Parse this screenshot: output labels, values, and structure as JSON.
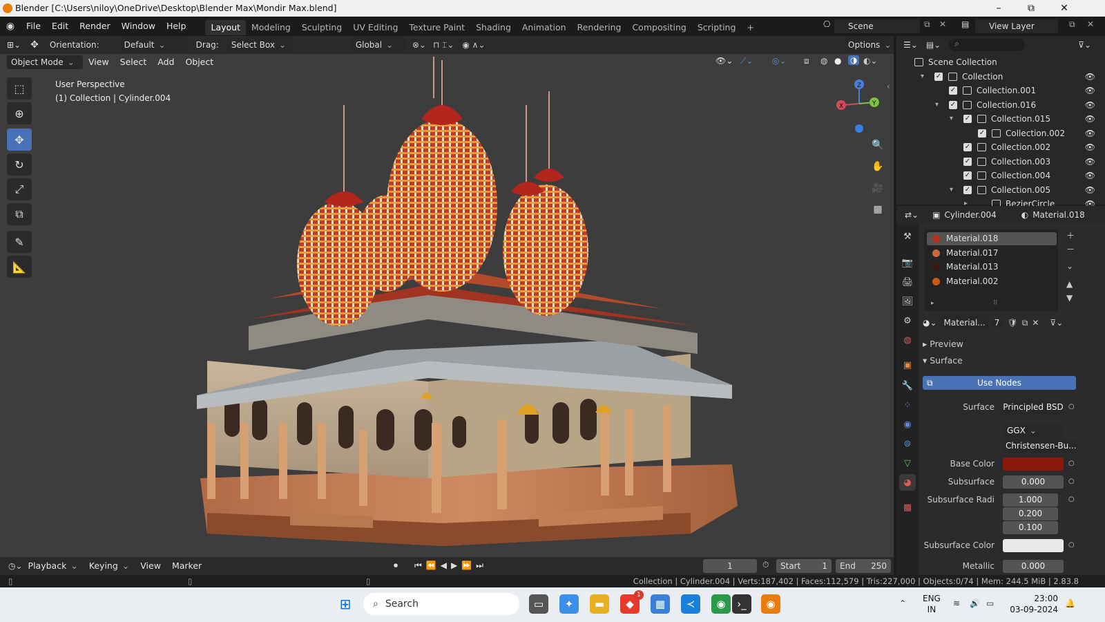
{
  "titlebar": {
    "title": "Blender [C:\\Users\\niloy\\OneDrive\\Desktop\\Blender Max\\Mondir Max.blend]",
    "minimize": "–",
    "maximize": "⧉",
    "close": "✕"
  },
  "menubar": {
    "items": [
      "File",
      "Edit",
      "Render",
      "Window",
      "Help"
    ],
    "workspaces": [
      "Layout",
      "Modeling",
      "Sculpting",
      "UV Editing",
      "Texture Paint",
      "Shading",
      "Animation",
      "Rendering",
      "Compositing",
      "Scripting"
    ],
    "active_workspace": "Layout",
    "add_workspace": "+",
    "scene_label": "Scene",
    "view_layer_label": "View Layer"
  },
  "viewport_header": {
    "orientation_label": "Orientation:",
    "orientation_value": "Default",
    "drag_label": "Drag:",
    "drag_value": "Select Box",
    "transform_orientation": "Global",
    "options_label": "Options",
    "mode": "Object Mode",
    "menus": [
      "View",
      "Select",
      "Add",
      "Object"
    ]
  },
  "viewport": {
    "perspective_label": "User Perspective",
    "context_label": "(1) Collection | Cylinder.004",
    "gizmo": {
      "x": "X",
      "y": "Y",
      "z": "Z"
    }
  },
  "timeline": {
    "menus": [
      "Playback",
      "Keying",
      "View",
      "Marker"
    ],
    "current_frame": "1",
    "start_label": "Start",
    "start_value": "1",
    "end_label": "End",
    "end_value": "250"
  },
  "statusbar": {
    "text": "Collection | Cylinder.004 | Verts:187,402 | Faces:112,579 | Tris:227,000 | Objects:0/74 | Mem: 244.5 MiB | 2.83.8"
  },
  "outliner": {
    "rows": [
      {
        "label": "Scene Collection",
        "indent": 0,
        "expand": "",
        "check": false,
        "eye": false
      },
      {
        "label": "Collection",
        "indent": 1,
        "expand": "▾",
        "check": true,
        "eye": true
      },
      {
        "label": "Collection.001",
        "indent": 2,
        "expand": "",
        "check": true,
        "eye": true
      },
      {
        "label": "Collection.016",
        "indent": 2,
        "expand": "▾",
        "check": true,
        "eye": true
      },
      {
        "label": "Collection.015",
        "indent": 3,
        "expand": "▾",
        "check": true,
        "eye": true
      },
      {
        "label": "Collection.002",
        "indent": 4,
        "expand": "",
        "check": true,
        "eye": true
      },
      {
        "label": "Collection.002",
        "indent": 3,
        "expand": "",
        "check": true,
        "eye": true
      },
      {
        "label": "Collection.003",
        "indent": 3,
        "expand": "",
        "check": true,
        "eye": true
      },
      {
        "label": "Collection.004",
        "indent": 3,
        "expand": "",
        "check": true,
        "eye": true
      },
      {
        "label": "Collection.005",
        "indent": 3,
        "expand": "▾",
        "check": true,
        "eye": true
      },
      {
        "label": "BezierCircle",
        "indent": 4,
        "expand": "▸",
        "check": false,
        "eye": true
      }
    ]
  },
  "properties": {
    "object_name": "Cylinder.004",
    "material_name": "Material.018",
    "materials": [
      {
        "name": "Material.018",
        "color": "#b5301e"
      },
      {
        "name": "Material.017",
        "color": "#c9683e"
      },
      {
        "name": "Material.013",
        "color": "#3a1a10"
      },
      {
        "name": "Material.002",
        "color": "#c75a18"
      }
    ],
    "material_field": "Material...",
    "user_count": "7",
    "preview_label": "Preview",
    "surface_panel_label": "Surface",
    "use_nodes_label": "Use Nodes",
    "surface_label": "Surface",
    "surface_value": "Principled BSD",
    "distribution": "GGX",
    "subsurface_method": "Christensen-Bu...",
    "base_color_label": "Base Color",
    "base_color": "#8b1a0c",
    "subsurface_label": "Subsurface",
    "subsurface_value": "0.000",
    "subsurface_radius_label": "Subsurface Radi",
    "subsurface_radius": [
      "1.000",
      "0.200",
      "0.100"
    ],
    "subsurface_color_label": "Subsurface Color",
    "subsurface_color": "#e8e8e8",
    "metallic_label": "Metallic",
    "metallic_value": "0.000"
  },
  "taskbar": {
    "search_label": "Search",
    "language": "ENG",
    "region": "IN",
    "time": "23:00",
    "date": "03-09-2024",
    "notification_badge": "1"
  }
}
